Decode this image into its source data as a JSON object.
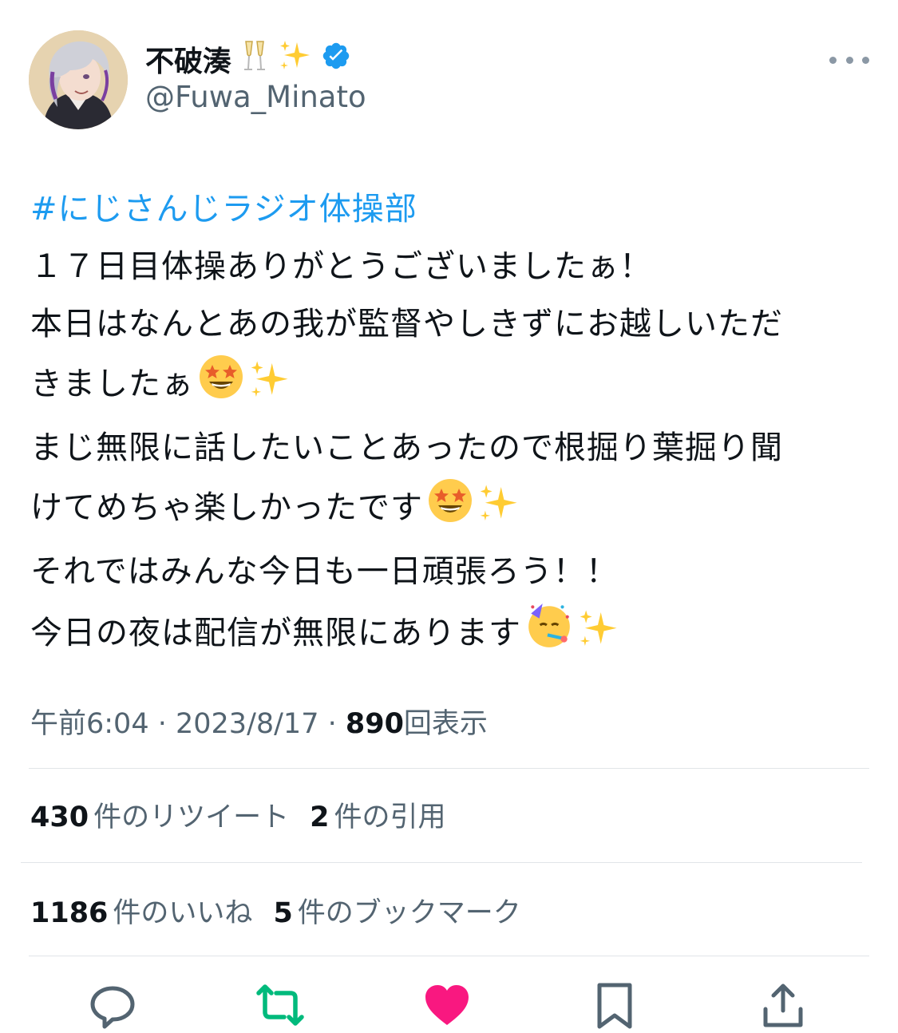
{
  "author": {
    "display_name": "不破湊",
    "name_emojis": [
      "champagne-glasses-emoji",
      "sparkles-emoji"
    ],
    "verified": true,
    "handle": "@Fuwa_Minato"
  },
  "tweet": {
    "hashtag": "#にじさんじラジオ体操部",
    "lines": [
      "１７日目体操ありがとうございましたぁ！",
      "本日はなんとあの我が監督やしきずにお越しいただ",
      "きましたぁ",
      "まじ無限に話したいことあったので根掘り葉掘り聞",
      "けてめちゃ楽しかったです",
      "それではみんな今日も一日頑張ろう！！",
      "今日の夜は配信が無限にあります"
    ]
  },
  "meta": {
    "time": "午前6:04",
    "sep": " · ",
    "date": "2023/8/17",
    "views_count": "890",
    "views_label": "回表示"
  },
  "stats": {
    "retweets_count": "430",
    "retweets_label": "件のリツイート",
    "quotes_count": "2",
    "quotes_label": "件の引用",
    "likes_count": "1186",
    "likes_label": "件のいいね",
    "bookmarks_count": "5",
    "bookmarks_label": "件のブックマーク"
  },
  "colors": {
    "link": "#1d9bf0",
    "secondary_text": "#536471",
    "retweet_green": "#00ba7c",
    "like_pink": "#f91880",
    "icon_gray": "#536471"
  }
}
